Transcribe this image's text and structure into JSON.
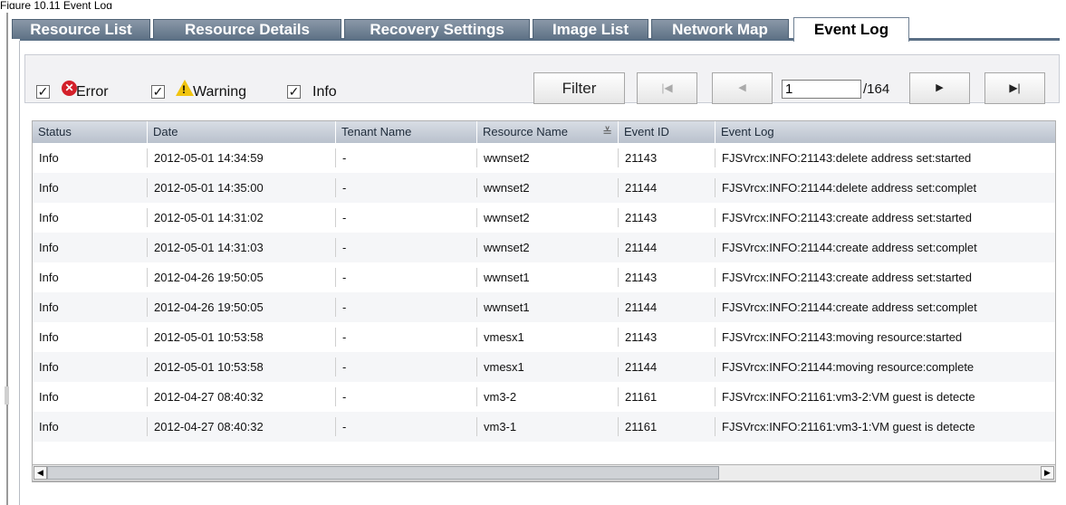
{
  "caption": "Figure 10.11 Event Log",
  "tabs": [
    {
      "label": "Resource List"
    },
    {
      "label": "Resource Details"
    },
    {
      "label": "Recovery Settings"
    },
    {
      "label": "Image List"
    },
    {
      "label": "Network Map"
    },
    {
      "label": "Event Log",
      "active": true
    }
  ],
  "filters": {
    "error": {
      "label": "Error",
      "checked": true,
      "check": "✓"
    },
    "warning": {
      "label": "Warning",
      "checked": true,
      "check": "✓"
    },
    "info": {
      "label": "Info",
      "checked": true,
      "check": "✓"
    }
  },
  "toolbar": {
    "filter_label": "Filter",
    "first_glyph": "|◀",
    "prev_glyph": "◀",
    "next_glyph": "▶",
    "last_glyph": "▶|",
    "page_value": "1",
    "page_total": "/164"
  },
  "table": {
    "columns": [
      "Status",
      "Date",
      "Tenant Name",
      "Resource Name",
      "Event ID",
      "Event Log"
    ],
    "sort_glyph": "≚",
    "rows": [
      [
        "Info",
        "2012-05-01 14:34:59",
        "-",
        "wwnset2",
        "21143",
        "FJSVrcx:INFO:21143:delete address set:started"
      ],
      [
        "Info",
        "2012-05-01 14:35:00",
        "-",
        "wwnset2",
        "21144",
        "FJSVrcx:INFO:21144:delete address set:complet"
      ],
      [
        "Info",
        "2012-05-01 14:31:02",
        "-",
        "wwnset2",
        "21143",
        "FJSVrcx:INFO:21143:create address set:started"
      ],
      [
        "Info",
        "2012-05-01 14:31:03",
        "-",
        "wwnset2",
        "21144",
        "FJSVrcx:INFO:21144:create address set:complet"
      ],
      [
        "Info",
        "2012-04-26 19:50:05",
        "-",
        "wwnset1",
        "21143",
        "FJSVrcx:INFO:21143:create address set:started"
      ],
      [
        "Info",
        "2012-04-26 19:50:05",
        "-",
        "wwnset1",
        "21144",
        "FJSVrcx:INFO:21144:create address set:complet"
      ],
      [
        "Info",
        "2012-05-01 10:53:58",
        "-",
        "vmesx1",
        "21143",
        "FJSVrcx:INFO:21143:moving resource:started"
      ],
      [
        "Info",
        "2012-05-01 10:53:58",
        "-",
        "vmesx1",
        "21144",
        "FJSVrcx:INFO:21144:moving resource:complete"
      ],
      [
        "Info",
        "2012-04-27 08:40:32",
        "-",
        "vm3-2",
        "21161",
        "FJSVrcx:INFO:21161:vm3-2:VM guest is detecte"
      ],
      [
        "Info",
        "2012-04-27 08:40:32",
        "-",
        "vm3-1",
        "21161",
        "FJSVrcx:INFO:21161:vm3-1:VM guest is detecte"
      ]
    ]
  },
  "scrollbar": {
    "left_glyph": "◀",
    "right_glyph": "▶"
  }
}
